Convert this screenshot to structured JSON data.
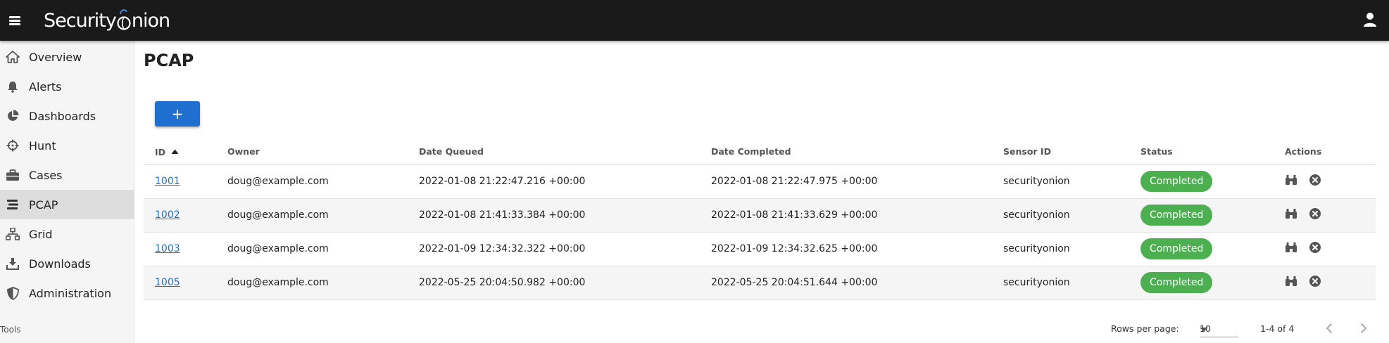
{
  "app": {
    "brand_part1": "Security",
    "brand_part2": "nion"
  },
  "sidebar": {
    "items": [
      {
        "label": "Overview",
        "icon": "home-icon"
      },
      {
        "label": "Alerts",
        "icon": "bell-icon"
      },
      {
        "label": "Dashboards",
        "icon": "pie-chart-icon"
      },
      {
        "label": "Hunt",
        "icon": "crosshairs-icon"
      },
      {
        "label": "Cases",
        "icon": "briefcase-icon"
      },
      {
        "label": "PCAP",
        "icon": "stream-icon",
        "active": true
      },
      {
        "label": "Grid",
        "icon": "network-icon"
      },
      {
        "label": "Downloads",
        "icon": "download-icon"
      },
      {
        "label": "Administration",
        "icon": "shield-icon"
      }
    ],
    "tools_label": "Tools"
  },
  "page": {
    "title": "PCAP",
    "add_label": "+"
  },
  "table": {
    "headers": [
      "ID",
      "Owner",
      "Date Queued",
      "Date Completed",
      "Sensor ID",
      "Status",
      "Actions"
    ],
    "sort_column": "ID",
    "rows": [
      {
        "id": "1001",
        "owner": "doug@example.com",
        "queued": "2022-01-08 21:22:47.216 +00:00",
        "completed": "2022-01-08 21:22:47.975 +00:00",
        "sensor": "securityonion",
        "status": "Completed"
      },
      {
        "id": "1002",
        "owner": "doug@example.com",
        "queued": "2022-01-08 21:41:33.384 +00:00",
        "completed": "2022-01-08 21:41:33.629 +00:00",
        "sensor": "securityonion",
        "status": "Completed"
      },
      {
        "id": "1003",
        "owner": "doug@example.com",
        "queued": "2022-01-09 12:34:32.322 +00:00",
        "completed": "2022-01-09 12:34:32.625 +00:00",
        "sensor": "securityonion",
        "status": "Completed"
      },
      {
        "id": "1005",
        "owner": "doug@example.com",
        "queued": "2022-05-25 20:04:50.982 +00:00",
        "completed": "2022-05-25 20:04:51.644 +00:00",
        "sensor": "securityonion",
        "status": "Completed"
      }
    ]
  },
  "footer": {
    "rows_per_page_label": "Rows per page:",
    "rows_per_page_value": "10",
    "range": "1-4 of 4"
  },
  "colors": {
    "topbar": "#1a1a1a",
    "accent": "#1e6fd0",
    "status_completed": "#4caf50"
  }
}
